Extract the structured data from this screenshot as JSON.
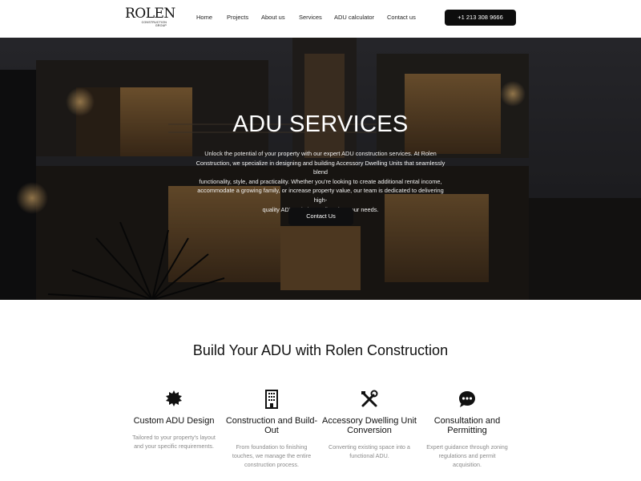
{
  "brand": {
    "name": "ROLEN",
    "subtitle_line1": "CONSTRUCTION",
    "subtitle_line2": "GROUP"
  },
  "nav": {
    "items": [
      {
        "label": "Home"
      },
      {
        "label": "Projects"
      },
      {
        "label": "About us"
      },
      {
        "label": "Services"
      },
      {
        "label": "ADU calculator"
      },
      {
        "label": "Contact us"
      }
    ],
    "phone": "+1 213 308 9666"
  },
  "hero": {
    "title": "ADU SERVICES",
    "lines": [
      "Unlock the potential of your property with our expert ADU construction services. At Rolen",
      "Construction, we specialize in designing and building Accessory Dwelling Units that seamlessly blend",
      "functionality, style, and practicality. Whether you're looking to create additional rental income,",
      "accommodate a growing family, or increase property value, our team is dedicated to delivering high-",
      "quality ADU solutions tailored to your needs."
    ],
    "button": "Contact Us"
  },
  "section": {
    "title": "Build Your ADU with Rolen Construction",
    "cards": [
      {
        "icon": "gear-badge-icon",
        "title_lines": [
          "Custom ADU Design"
        ],
        "desc_lines": [
          "Tailored to your property's layout",
          "and your specific requirements."
        ]
      },
      {
        "icon": "building-icon",
        "title_lines": [
          "Construction and Build-",
          "Out"
        ],
        "desc_lines": [
          "From foundation to finishing",
          "touches, we manage the entire",
          "construction process."
        ]
      },
      {
        "icon": "tools-icon",
        "title_lines": [
          "Accessory Dwelling Unit",
          "Conversion"
        ],
        "desc_lines": [
          "Converting existing space into a",
          "functional ADU."
        ]
      },
      {
        "icon": "chat-bubble-icon",
        "title_lines": [
          "Consultation and",
          "Permitting"
        ],
        "desc_lines": [
          "Expert guidance through zoning",
          "regulations and permit acquisition."
        ]
      }
    ]
  },
  "colors": {
    "button_bg": "#0d0d0d",
    "text_muted": "#8a8a8a",
    "hero_overlay": "#1e1e20"
  }
}
